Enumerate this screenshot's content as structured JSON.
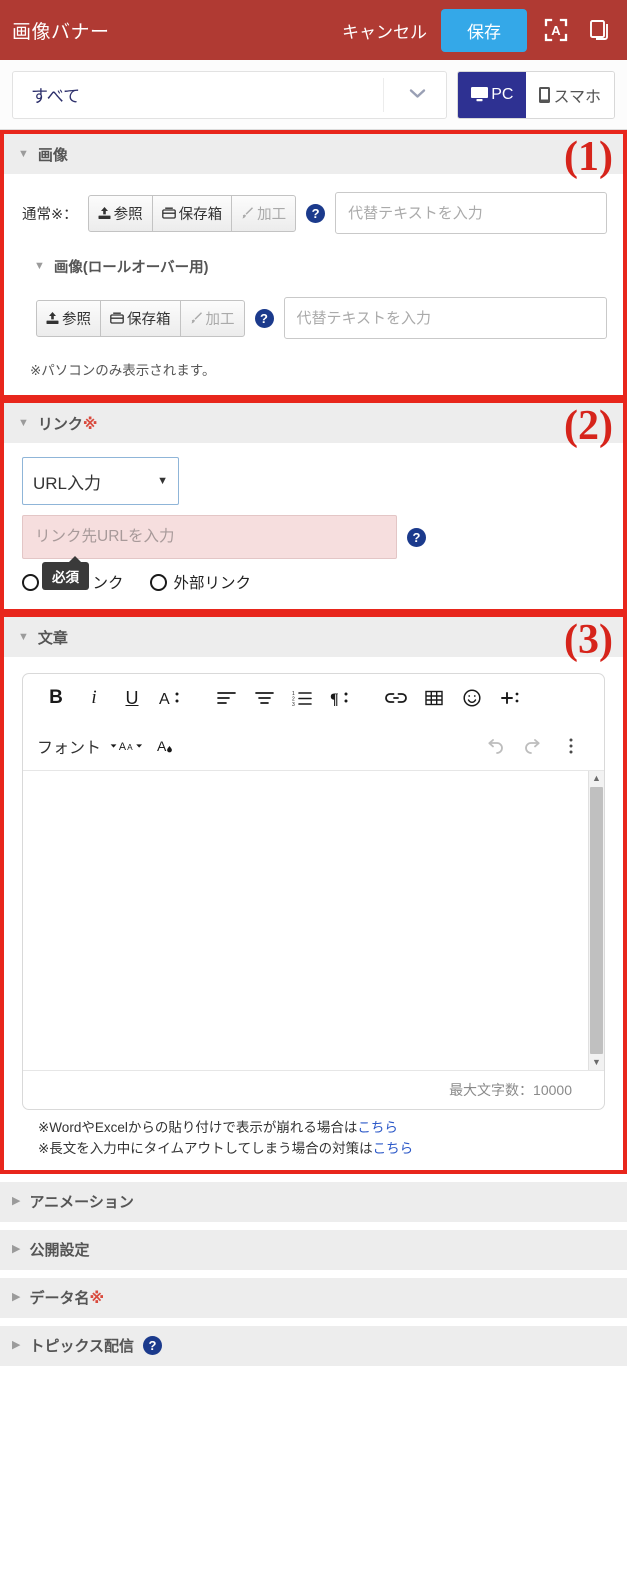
{
  "colors": {
    "header_bg": "#b03a33",
    "save_btn": "#34a8e8",
    "device_active": "#2e3192",
    "annotation_red": "#e8261c",
    "required_pink": "#f6dede",
    "help_blue": "#1b3a8c",
    "link_blue": "#2b58c8"
  },
  "header": {
    "title": "画像バナー",
    "cancel_label": "キャンセル",
    "save_label": "保存",
    "translate_icon": "translate-a-icon",
    "duplicate_icon": "duplicate-icon"
  },
  "subbar": {
    "filter_value": "すべて",
    "chevron_icon": "chevron-down-icon",
    "devices": [
      {
        "label": "PC",
        "icon": "desktop-icon",
        "active": true
      },
      {
        "label": "スマホ",
        "icon": "mobile-icon",
        "active": false
      }
    ]
  },
  "annotations": [
    {
      "label": "(1)"
    },
    {
      "label": "(2)"
    },
    {
      "label": "(3)"
    }
  ],
  "image_section": {
    "title": "画像",
    "triangle_icon": "triangle-down-icon",
    "normal_label": "通常※：",
    "buttons": [
      {
        "label": "参照",
        "icon": "upload-icon",
        "disabled": false
      },
      {
        "label": "保存箱",
        "icon": "box-icon",
        "disabled": false
      },
      {
        "label": "加工",
        "icon": "brush-icon",
        "disabled": true
      }
    ],
    "help_icon": "help-icon",
    "alt_placeholder": "代替テキストを入力",
    "alt_value": "",
    "rollover": {
      "title": "画像(ロールオーバー用)",
      "triangle_icon": "triangle-down-icon",
      "buttons": [
        {
          "label": "参照",
          "icon": "upload-icon",
          "disabled": false
        },
        {
          "label": "保存箱",
          "icon": "box-icon",
          "disabled": false
        },
        {
          "label": "加工",
          "icon": "brush-icon",
          "disabled": true
        }
      ],
      "help_icon": "help-icon",
      "alt_placeholder": "代替テキストを入力",
      "alt_value": "",
      "note": "※パソコンのみ表示されます。"
    }
  },
  "link_section": {
    "title": "リンク",
    "required_mark": "※",
    "triangle_icon": "triangle-down-icon",
    "type_select_value": "URL入力",
    "type_select_caret": "caret-down-icon",
    "url_placeholder": "リンク先URLを入力",
    "url_value": "",
    "help_icon": "help-icon",
    "tooltip_text": "必須",
    "radios": [
      {
        "label": "内部リンク",
        "selected": false
      },
      {
        "label": "外部リンク",
        "selected": false
      }
    ]
  },
  "text_section": {
    "title": "文章",
    "triangle_icon": "triangle-down-icon",
    "toolbar_row1": [
      {
        "name": "bold-icon",
        "glyph": "B"
      },
      {
        "name": "italic-icon",
        "glyph": "i"
      },
      {
        "name": "underline-icon",
        "glyph": "U"
      },
      {
        "name": "text-color-icon",
        "glyph": "A"
      },
      {
        "name": "align-left-icon",
        "glyph": "align"
      },
      {
        "name": "align-center-icon",
        "glyph": "align"
      },
      {
        "name": "numbered-list-icon",
        "glyph": "list"
      },
      {
        "name": "paragraph-icon",
        "glyph": "¶"
      },
      {
        "name": "link-icon",
        "glyph": "link"
      },
      {
        "name": "table-icon",
        "glyph": "table"
      },
      {
        "name": "emoji-icon",
        "glyph": "☺"
      },
      {
        "name": "insert-plus-icon",
        "glyph": "+"
      }
    ],
    "toolbar_row2": {
      "font_label": "フォント",
      "font_caret_icon": "caret-down-icon",
      "font_size_icon": "font-size-icon",
      "highlight_icon": "text-highlight-icon",
      "undo_icon": "undo-icon",
      "redo_icon": "redo-icon",
      "more_icon": "more-vertical-icon"
    },
    "editor_content": "",
    "scrollbar": {
      "up_icon": "scroll-up-icon",
      "down_icon": "scroll-down-icon"
    },
    "counter_label": "最大文字数：10000",
    "footnotes": [
      {
        "prefix": "※WordやExcelからの貼り付けで表示が崩れる場合は",
        "link": "こちら"
      },
      {
        "prefix": "※長文を入力中にタイムアウトしてしまう場合の対策は",
        "link": "こちら"
      }
    ]
  },
  "collapsed_sections": [
    {
      "title": "アニメーション",
      "required_mark": "",
      "has_help": false
    },
    {
      "title": "公開設定",
      "required_mark": "",
      "has_help": false
    },
    {
      "title": "データ名",
      "required_mark": "※",
      "has_help": false
    },
    {
      "title": "トピックス配信",
      "required_mark": "",
      "has_help": true
    }
  ]
}
